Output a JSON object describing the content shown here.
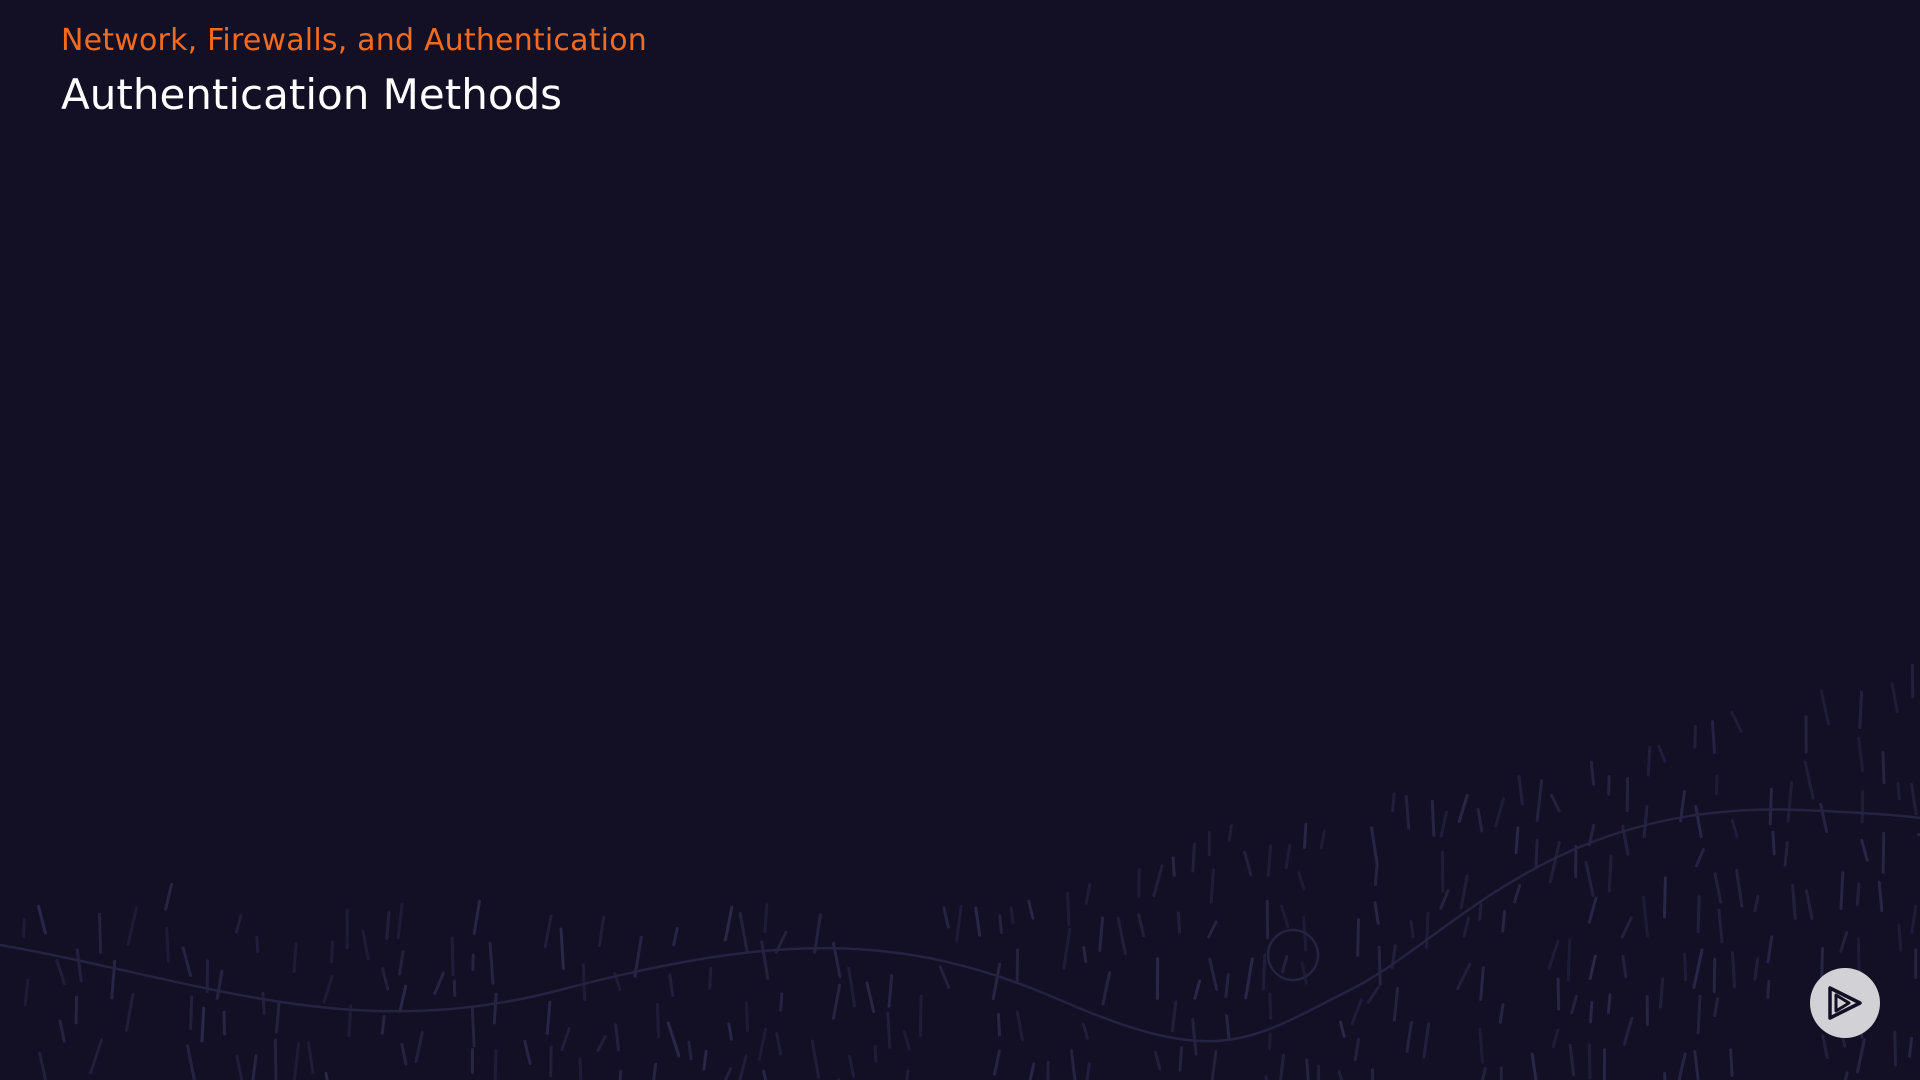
{
  "slide": {
    "course_title": "Network, Firewalls, and Authentication",
    "title": "Authentication Methods"
  },
  "logo": {
    "icon": "play-logo-icon"
  },
  "colors": {
    "background": "#130f24",
    "accent": "#f46b1d",
    "title": "#ffffff",
    "decor_lines": "#2a2748",
    "logo_bg": "#d2d2d6",
    "logo_fg": "#130f24"
  }
}
